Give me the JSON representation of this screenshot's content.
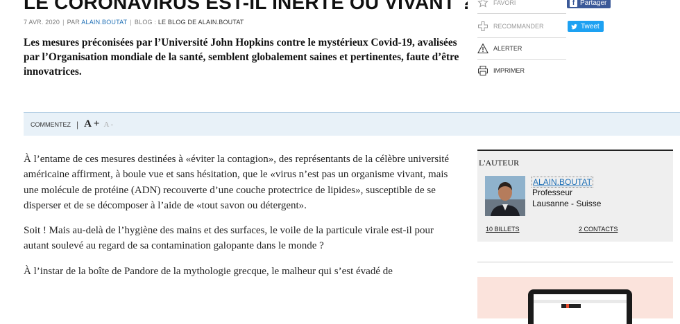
{
  "article": {
    "headline": "LE CORONAVIRUS EST-IL INERTE OU VIVANT ?",
    "meta": {
      "date": "7 AVR. 2020",
      "by_prefix": "PAR",
      "author": "ALAIN.BOUTAT",
      "blog_prefix": "BLOG :",
      "blog_name": "LE BLOG DE ALAIN.BOUTAT"
    },
    "lead": "Les mesures préconisées par l’Université John Hopkins contre le mystérieux Covid-19, avalisées par l’Organisation mondiale de la santé, semblent globalement saines et pertinentes, faute d’être innovatrices.",
    "paragraphs": [
      "À l’entame de ces mesures destinées à «éviter la contagion», des représentants de la célèbre université américaine affirment, à boule vue et sans hésitation, que le «virus n’est pas un organisme vivant, mais une molécule de protéine (ADN) recouverte d’une couche protectrice de lipides», susceptible de se disperser et de se décomposer à l’aide de «tout savon ou détergent».",
      "Soit ! Mais au-delà de l’hygiène des mains et des surfaces, le voile de la particule virale est-il pour autant soulevé au regard de sa contamination galopante dans le monde ?",
      "À l’instar de la boîte de Pandore de la mythologie grecque, le malheur qui s’est évadé de"
    ]
  },
  "actions": {
    "favori": "FAVORI",
    "recommander": "RECOMMANDER",
    "alerter": "ALERTER",
    "imprimer": "IMPRIMER",
    "facebook": "Partager",
    "twitter": "Tweet"
  },
  "toolbar": {
    "comment": "COMMENTEZ",
    "font_increase": "A +",
    "font_decrease": "A -"
  },
  "author_box": {
    "title": "L'AUTEUR",
    "name": "ALAIN.BOUTAT",
    "role": "Professeur",
    "location": "Lausanne - Suisse",
    "posts": "10 BILLETS",
    "contacts": "2 CONTACTS"
  },
  "colors": {
    "link": "#1e6fb5",
    "facebook": "#3b5998",
    "twitter": "#1da1f2",
    "toolbar_bg": "#e8f1f8",
    "promo_bg": "#fbe3dc"
  }
}
